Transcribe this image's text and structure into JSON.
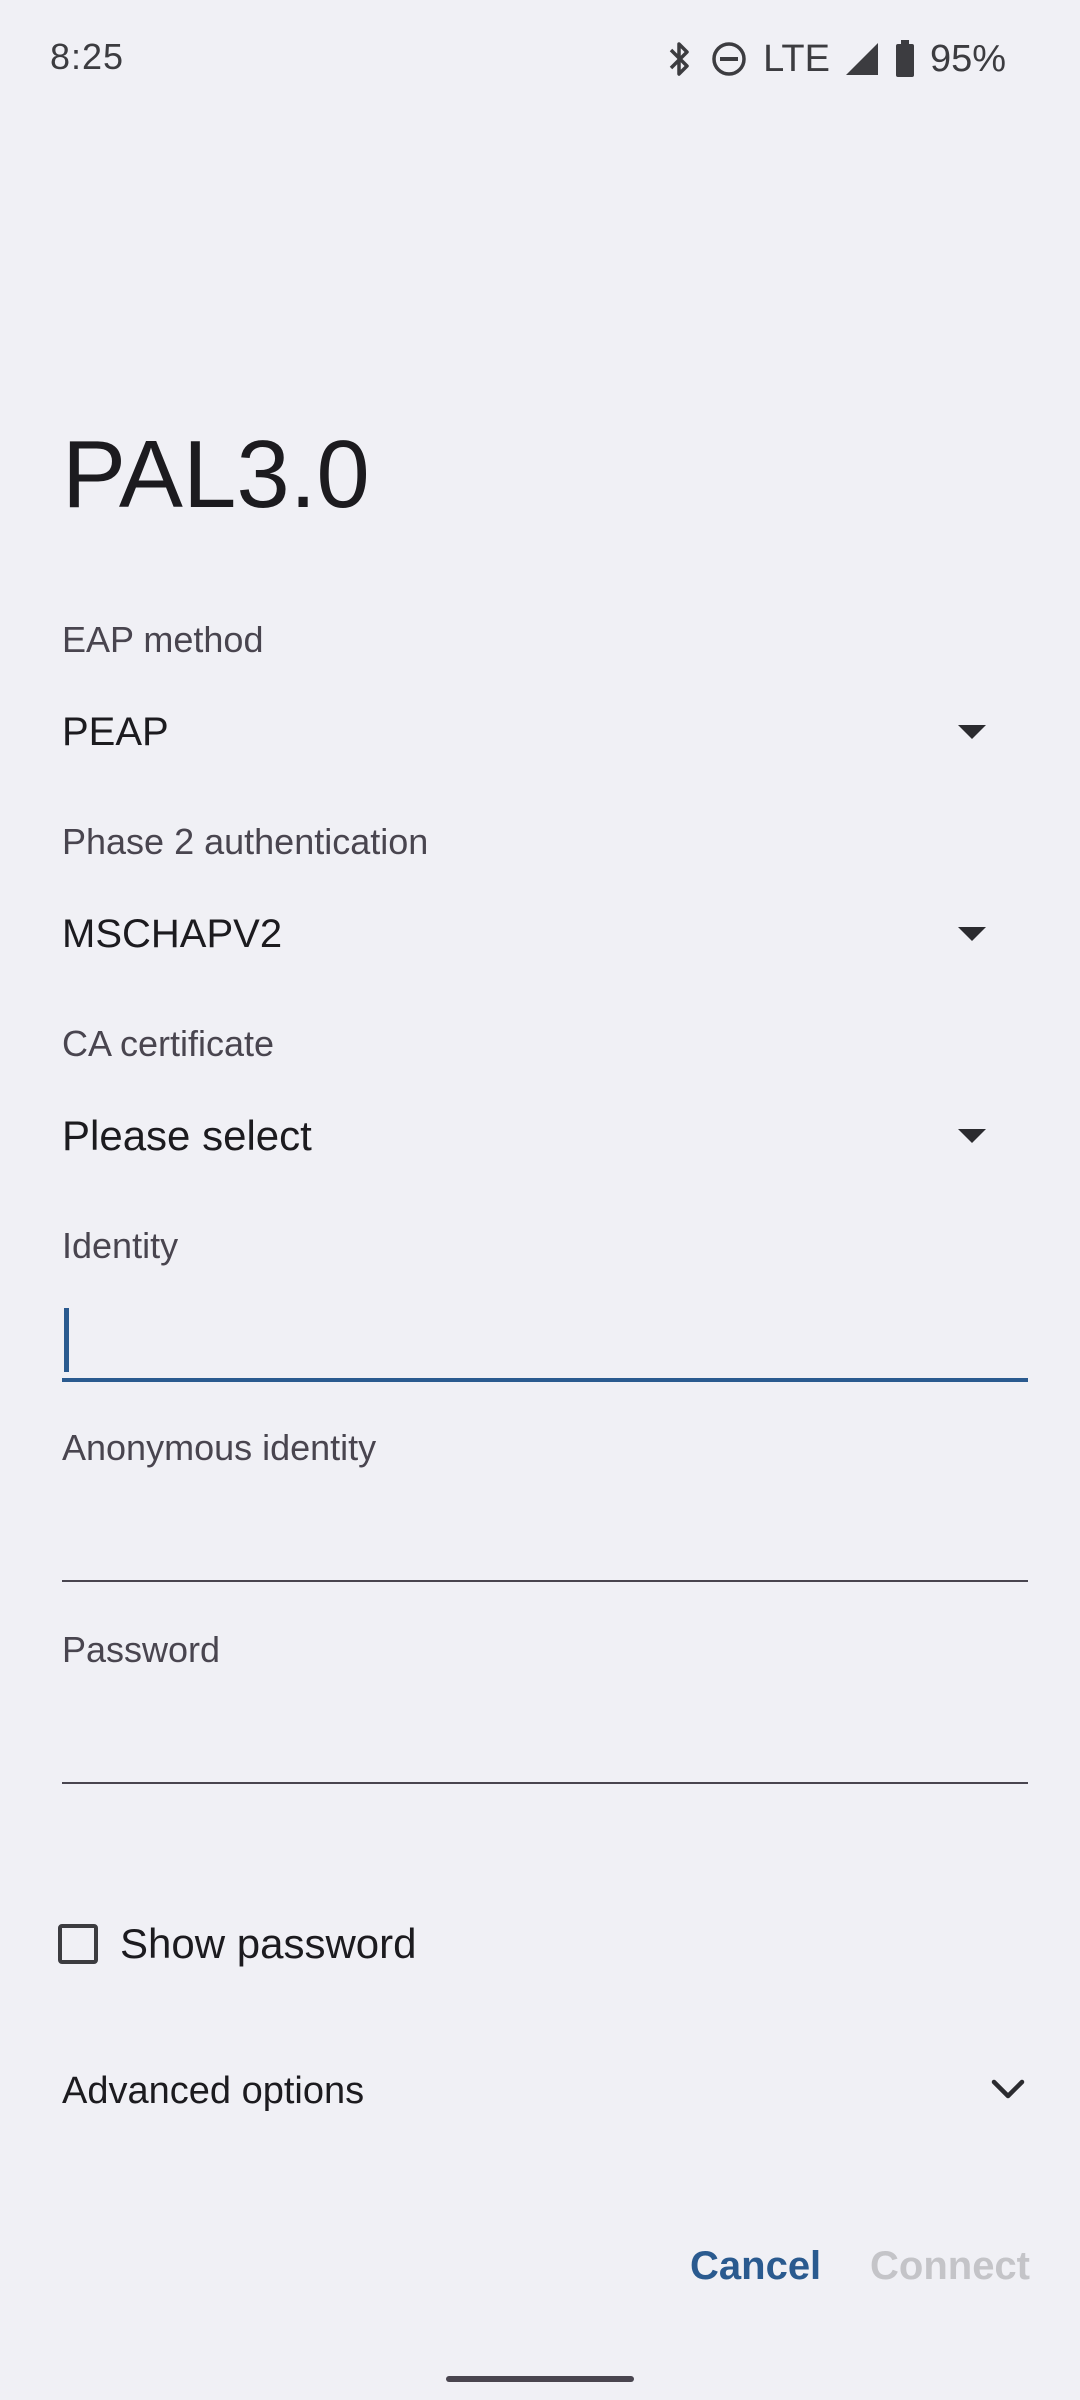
{
  "status_bar": {
    "time": "8:25",
    "network": "LTE",
    "battery": "95%",
    "icons": [
      "bluetooth-icon",
      "do-not-disturb-icon",
      "signal-icon",
      "battery-icon"
    ]
  },
  "dialog": {
    "title": "PAL3.0",
    "eap_method": {
      "label": "EAP method",
      "value": "PEAP"
    },
    "phase2": {
      "label": "Phase 2 authentication",
      "value": "MSCHAPV2"
    },
    "ca_certificate": {
      "label": "CA certificate",
      "value": "Please select"
    },
    "identity": {
      "label": "Identity",
      "value": ""
    },
    "anonymous_identity": {
      "label": "Anonymous identity",
      "value": ""
    },
    "password": {
      "label": "Password",
      "value": ""
    },
    "show_password": {
      "label": "Show password",
      "checked": false
    },
    "advanced_options": {
      "label": "Advanced options"
    },
    "buttons": {
      "cancel": "Cancel",
      "connect": "Connect"
    }
  },
  "colors": {
    "background": "#f0f0f5",
    "accent": "#2a5a8f",
    "disabled": "#c4c4c8",
    "text": "#1c1b1f",
    "label": "#49454f"
  }
}
